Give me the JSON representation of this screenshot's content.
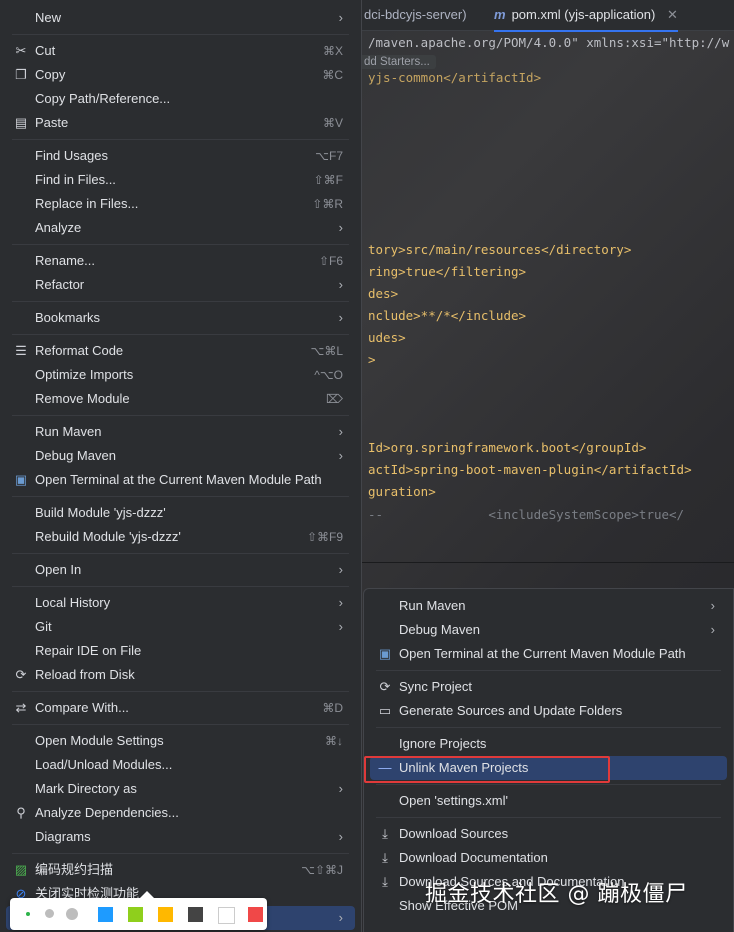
{
  "tabs": [
    {
      "label": "dci-bdcyjs-server)"
    },
    {
      "label": "pom.xml (yjs-application)",
      "icon": "maven-icon"
    }
  ],
  "editor": {
    "hint": "dd Starters...",
    "lines": [
      "/maven.apache.org/POM/4.0.0\" xmlns:xsi=\"http://w",
      "yjs-common</artifactId>",
      "tory>src/main/resources</directory>",
      "ring>true</filtering>",
      "des>",
      "nclude>**/*</include>",
      "udes>",
      ">",
      "Id>org.springframework.boot</groupId>",
      "actId>spring-boot-maven-plugin</artifactId>",
      "guration>",
      "--              <includeSystemScope>true</"
    ]
  },
  "menu": {
    "groups": [
      [
        {
          "label": "New",
          "submenu": true
        }
      ],
      [
        {
          "label": "Cut",
          "shortcut": "⌘X",
          "icon": "scissors-icon"
        },
        {
          "label": "Copy",
          "shortcut": "⌘C",
          "icon": "copy-icon"
        },
        {
          "label": "Copy Path/Reference..."
        },
        {
          "label": "Paste",
          "shortcut": "⌘V",
          "icon": "paste-icon"
        }
      ],
      [
        {
          "label": "Find Usages",
          "shortcut": "⌥F7"
        },
        {
          "label": "Find in Files...",
          "shortcut": "⇧⌘F"
        },
        {
          "label": "Replace in Files...",
          "shortcut": "⇧⌘R"
        },
        {
          "label": "Analyze",
          "submenu": true
        }
      ],
      [
        {
          "label": "Rename...",
          "shortcut": "⇧F6"
        },
        {
          "label": "Refactor",
          "submenu": true
        }
      ],
      [
        {
          "label": "Bookmarks",
          "submenu": true
        }
      ],
      [
        {
          "label": "Reformat Code",
          "shortcut": "⌥⌘L",
          "icon": "reformat-icon"
        },
        {
          "label": "Optimize Imports",
          "shortcut": "^⌥O"
        },
        {
          "label": "Remove Module",
          "shortcut": "⌦"
        }
      ],
      [
        {
          "label": "Run Maven",
          "submenu": true
        },
        {
          "label": "Debug Maven",
          "submenu": true
        },
        {
          "label": "Open Terminal at the Current Maven Module Path",
          "icon": "terminal-icon"
        }
      ],
      [
        {
          "label": "Build Module 'yjs-dzzz'"
        },
        {
          "label": "Rebuild Module 'yjs-dzzz'",
          "shortcut": "⇧⌘F9"
        }
      ],
      [
        {
          "label": "Open In",
          "submenu": true
        }
      ],
      [
        {
          "label": "Local History",
          "submenu": true
        },
        {
          "label": "Git",
          "submenu": true
        },
        {
          "label": "Repair IDE on File"
        },
        {
          "label": "Reload from Disk",
          "icon": "reload-icon"
        }
      ],
      [
        {
          "label": "Compare With...",
          "shortcut": "⌘D",
          "icon": "compare-icon"
        }
      ],
      [
        {
          "label": "Open Module Settings",
          "shortcut": "⌘↓"
        },
        {
          "label": "Load/Unload Modules..."
        },
        {
          "label": "Mark Directory as",
          "submenu": true
        },
        {
          "label": "Analyze Dependencies...",
          "icon": "analyze-icon"
        },
        {
          "label": "Diagrams",
          "submenu": true
        }
      ],
      [
        {
          "label": "编码规约扫描",
          "shortcut": "⌥⇧⌘J",
          "icon": "scan-icon"
        },
        {
          "label": "关闭实时检测功能",
          "icon": "disable-icon"
        },
        {
          "label": "",
          "submenu": true,
          "selected": true
        }
      ]
    ]
  },
  "submenu": {
    "groups": [
      [
        {
          "label": "Run Maven",
          "submenu": true
        },
        {
          "label": "Debug Maven",
          "submenu": true
        },
        {
          "label": "Open Terminal at the Current Maven Module Path",
          "icon": "terminal-icon"
        }
      ],
      [
        {
          "label": "Sync Project",
          "icon": "sync-icon"
        },
        {
          "label": "Generate Sources and Update Folders",
          "icon": "generate-folder-icon"
        }
      ],
      [
        {
          "label": "Ignore Projects"
        },
        {
          "label": "Unlink Maven Projects",
          "icon": "minus-icon",
          "selected": true
        }
      ],
      [
        {
          "label": "Open 'settings.xml'"
        }
      ],
      [
        {
          "label": "Download Sources",
          "icon": "download-icon"
        },
        {
          "label": "Download Documentation",
          "icon": "download-icon"
        },
        {
          "label": "Download Sources and Documentation",
          "icon": "download-icon"
        },
        {
          "label": "Show Effective POM"
        }
      ]
    ]
  },
  "palette": {
    "colors": [
      "#1e9bff",
      "#8fcf1c",
      "#ffb800",
      "#444444",
      "#ffffff",
      "#f04848"
    ]
  },
  "watermark": "掘金技术社区 @ 蹦极僵尸"
}
